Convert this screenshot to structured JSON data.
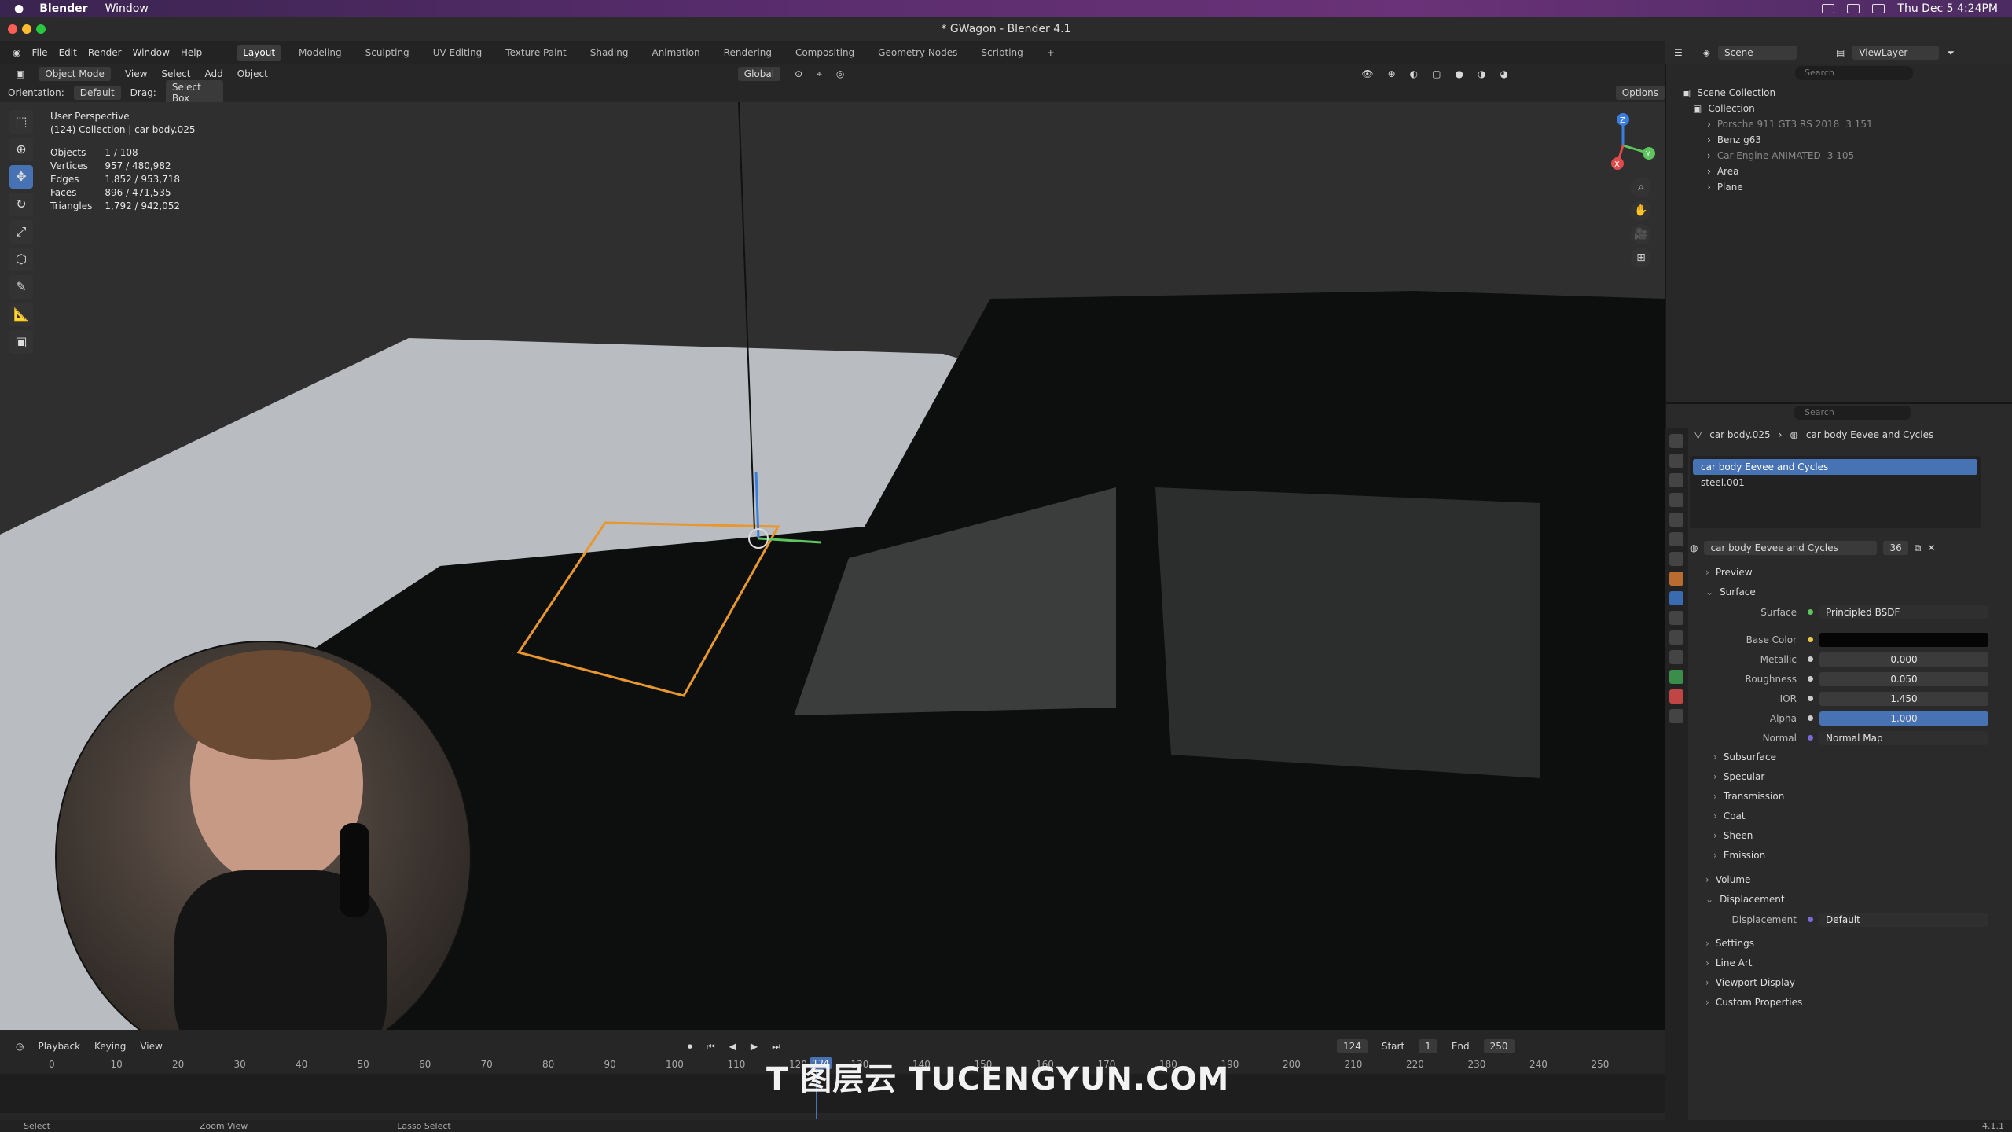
{
  "macos": {
    "app": "Blender",
    "menu": [
      "Window"
    ],
    "datetime": "Thu Dec 5  4:24PM"
  },
  "window_title": "* GWagon - Blender 4.1",
  "menu": [
    "File",
    "Edit",
    "Render",
    "Window",
    "Help"
  ],
  "workspace_tabs": [
    "Layout",
    "Modeling",
    "Sculpting",
    "UV Editing",
    "Texture Paint",
    "Shading",
    "Animation",
    "Rendering",
    "Compositing",
    "Geometry Nodes",
    "Scripting",
    "+"
  ],
  "viewport_header": {
    "mode": "Object Mode",
    "menus": [
      "View",
      "Select",
      "Add",
      "Object"
    ],
    "transform": "Global",
    "options": "Options"
  },
  "tool_header": {
    "orientation_label": "Orientation:",
    "orientation": "Default",
    "drag_label": "Drag:",
    "drag": "Select Box"
  },
  "overlay": {
    "perspective": "User Perspective",
    "collection": "(124) Collection | car body.025",
    "stats": [
      [
        "Objects",
        "1 / 108"
      ],
      [
        "Vertices",
        "957 / 480,982"
      ],
      [
        "Edges",
        "1,852 / 953,718"
      ],
      [
        "Faces",
        "896 / 471,535"
      ],
      [
        "Triangles",
        "1,792 / 942,052"
      ]
    ]
  },
  "gizmo": {
    "x": "X",
    "y": "Y",
    "z": "Z"
  },
  "outliner": {
    "scene": "Scene",
    "view_layer": "ViewLayer",
    "search": "Search",
    "scene_collection": "Scene Collection",
    "collection": "Collection",
    "items": [
      {
        "name": "Porsche 911 GT3 RS 2018",
        "count": "3 151"
      },
      {
        "name": "Benz g63",
        "count": ""
      },
      {
        "name": "Car Engine ANIMATED",
        "count": "3 105"
      },
      {
        "name": "Area",
        "count": ""
      },
      {
        "name": "Plane",
        "count": ""
      }
    ]
  },
  "properties": {
    "search": "Search",
    "breadcrumb_object": "car body.025",
    "breadcrumb_material": "car body Eevee and Cycles",
    "slots": [
      "car body Eevee and Cycles",
      "steel.001"
    ],
    "material_name": "car body Eevee and Cycles",
    "users": "36",
    "sections_top": [
      "Preview"
    ],
    "surface_label": "Surface",
    "surface_shader_label": "Surface",
    "surface_shader": "Principled BSDF",
    "inputs": [
      {
        "label": "Base Color",
        "value": ""
      },
      {
        "label": "Metallic",
        "value": "0.000"
      },
      {
        "label": "Roughness",
        "value": "0.050"
      },
      {
        "label": "IOR",
        "value": "1.450"
      },
      {
        "label": "Alpha",
        "value": "1.000"
      },
      {
        "label": "Normal",
        "value": "Normal Map"
      }
    ],
    "subsections": [
      "Subsurface",
      "Specular",
      "Transmission",
      "Coat",
      "Sheen",
      "Emission"
    ],
    "volume": "Volume",
    "displacement": "Displacement",
    "displacement_label": "Displacement",
    "displacement_value": "Default",
    "bottom_sections": [
      "Settings",
      "Line Art",
      "Viewport Display",
      "Custom Properties"
    ]
  },
  "timeline": {
    "menus": [
      "Playback",
      "Keying",
      "View"
    ],
    "current_frame": "124",
    "start_label": "Start",
    "start": "1",
    "end_label": "End",
    "end": "250",
    "playhead_label": "124",
    "ticks": [
      "0",
      "10",
      "20",
      "30",
      "40",
      "50",
      "60",
      "70",
      "80",
      "90",
      "100",
      "110",
      "120",
      "130",
      "140",
      "150",
      "160",
      "170",
      "180",
      "190",
      "200",
      "210",
      "220",
      "230",
      "240",
      "250"
    ]
  },
  "statusbar": {
    "items": [
      "Select",
      "Zoom View",
      "Lasso Select"
    ],
    "version": "4.1.1"
  },
  "watermark": "T 图层云 TUCENGYUN.COM",
  "colors": {
    "accent": "#4772b3",
    "selection_orange": "#e8962e"
  }
}
